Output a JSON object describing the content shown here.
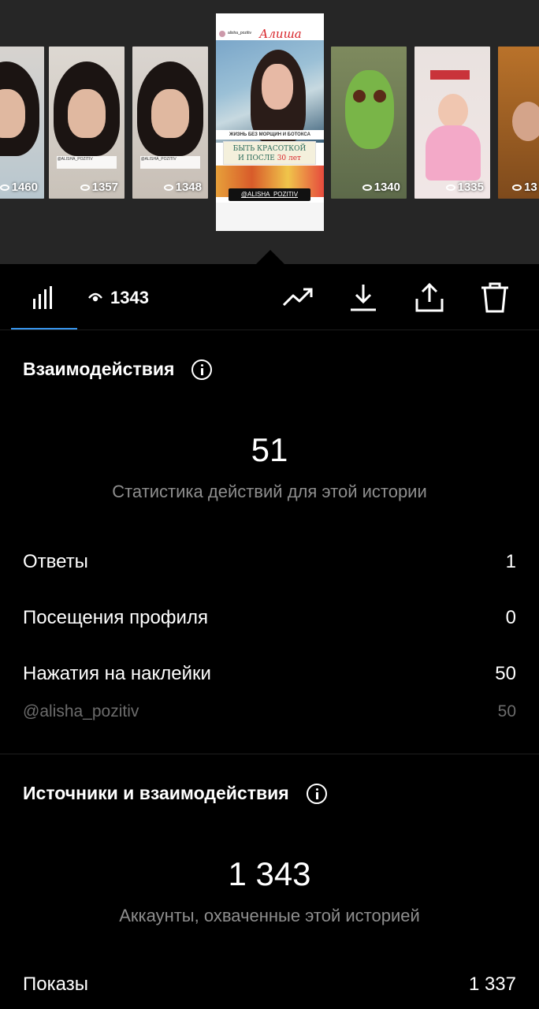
{
  "carousel": {
    "thumbs": [
      {
        "count": "1460"
      },
      {
        "count": "1357",
        "caption": "@ALISHA_POZITIV"
      },
      {
        "count": "1348",
        "caption": "@ALISHA_POZITIV"
      },
      {
        "count": "1340"
      },
      {
        "count": "1335"
      },
      {
        "count": "13"
      }
    ],
    "selected": {
      "username": "alisha_pozitiv",
      "title": "Алиша",
      "banner": "ЖИЗНЬ БЕЗ МОРЩИН И БОТОКСА",
      "box_line1": "БЫТЬ КРАСОТКОЙ",
      "box_line2_a": "И ПОСЛЕ ",
      "box_line2_b": "30 лет",
      "tag": "@ALISHA_POZITIV"
    }
  },
  "toolbar": {
    "views": "1343",
    "icons": [
      "bar-chart-icon",
      "eye-icon",
      "trending-icon",
      "download-icon",
      "share-icon",
      "trash-icon"
    ]
  },
  "interactions": {
    "title": "Взаимодействия",
    "total": "51",
    "subtitle": "Статистика действий для этой истории",
    "rows": [
      {
        "label": "Ответы",
        "value": "1"
      },
      {
        "label": "Посещения профиля",
        "value": "0"
      },
      {
        "label": "Нажатия на наклейки",
        "value": "50"
      }
    ],
    "sticker": {
      "label": "@alisha_pozitiv",
      "value": "50"
    }
  },
  "sources": {
    "title": "Источники и взаимодействия",
    "total": "1 343",
    "subtitle": "Аккаунты, охваченные этой историей",
    "rows": [
      {
        "label": "Показы",
        "value": "1 337"
      }
    ]
  },
  "colors": {
    "background": "#000000",
    "carousel_bg": "#262626",
    "accent": "#3897f0",
    "muted": "#8e8e8e"
  }
}
